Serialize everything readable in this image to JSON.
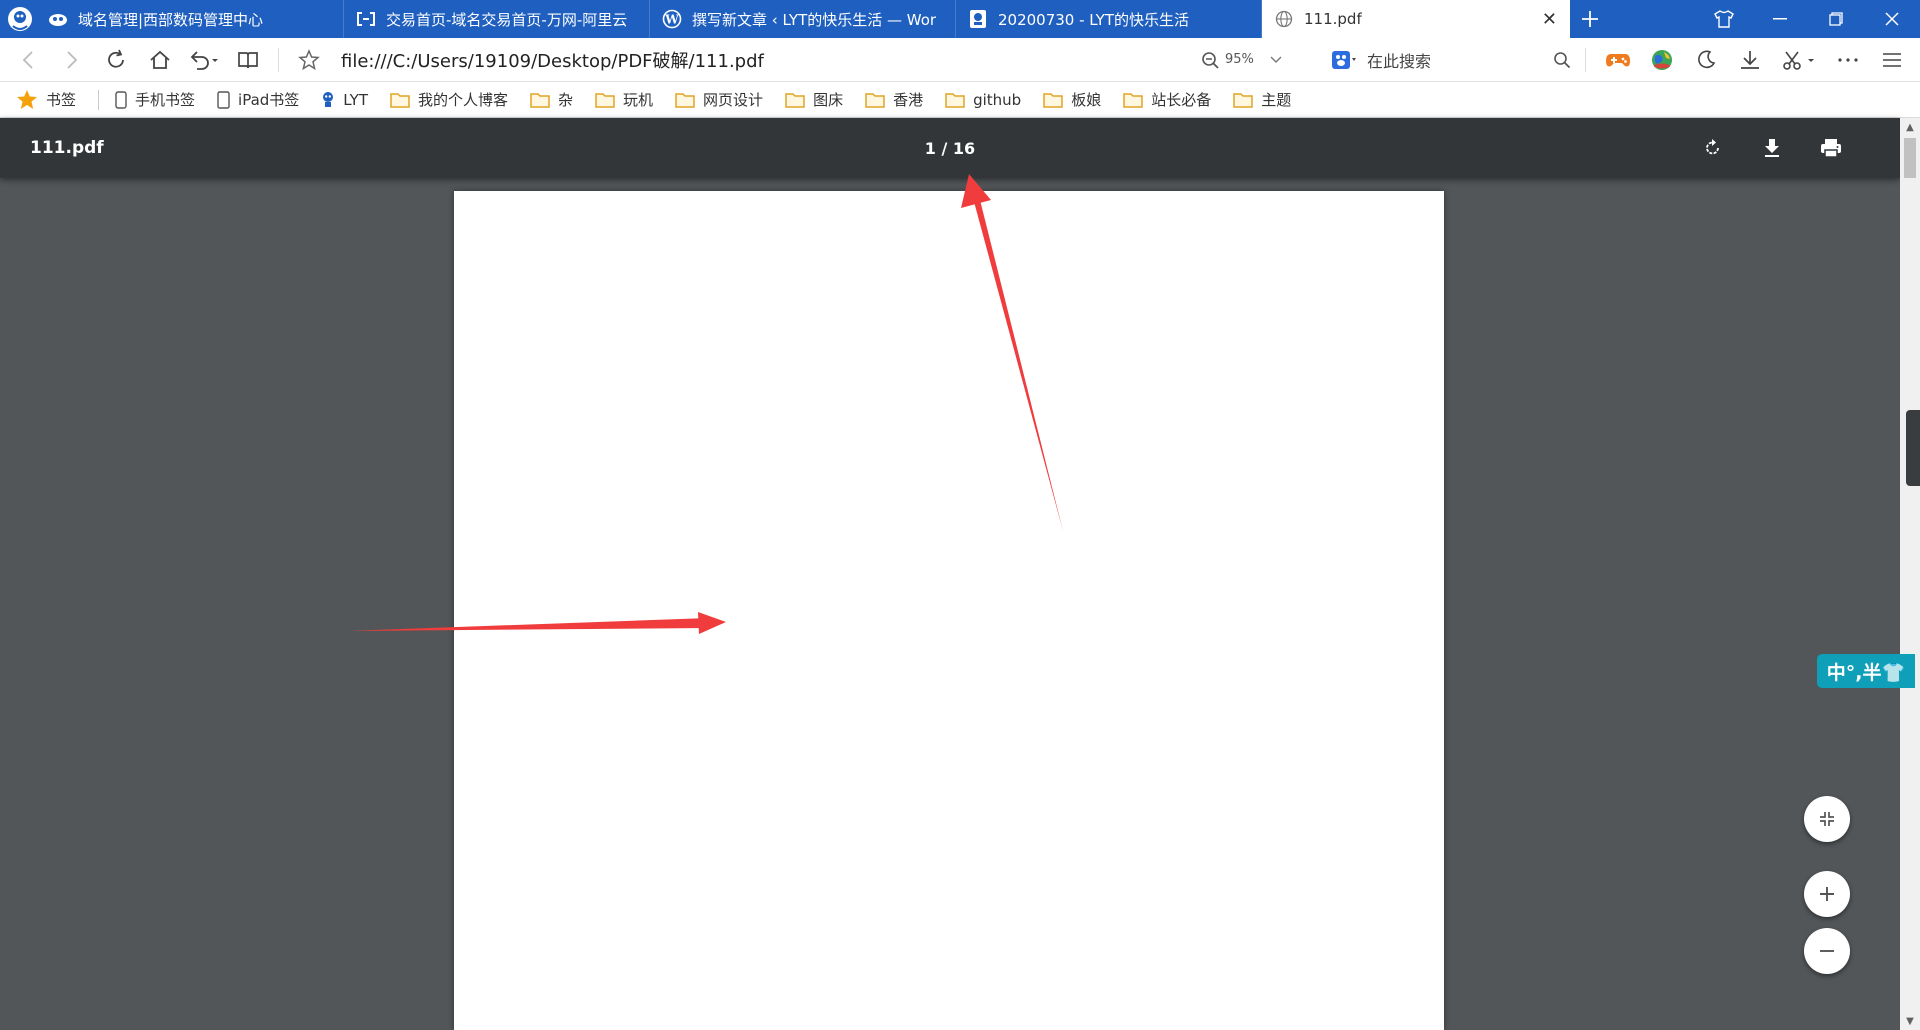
{
  "tabs": [
    {
      "title": "域名管理|西部数码管理中心",
      "icon": "west-digital-icon"
    },
    {
      "title": "交易首页-域名交易首页-万网-阿里云",
      "icon": "aliyun-icon"
    },
    {
      "title": "撰写新文章 ‹ LYT的快乐生活 — Wor",
      "icon": "wordpress-icon"
    },
    {
      "title": "20200730 - LYT的快乐生活",
      "icon": "site-icon"
    },
    {
      "title": "111.pdf",
      "icon": "globe-icon",
      "active": true
    }
  ],
  "address": {
    "url": "file:///C:/Users/19109/Desktop/PDF破解/111.pdf",
    "zoom": "95%",
    "search_placeholder": "在此搜索"
  },
  "bookmarks": [
    {
      "label": "书签",
      "icon": "star-icon"
    },
    {
      "label": "手机书签",
      "icon": "phone-icon"
    },
    {
      "label": "iPad书签",
      "icon": "tablet-icon"
    },
    {
      "label": "LYT",
      "icon": "site-icon"
    },
    {
      "label": "我的个人博客",
      "icon": "folder-icon"
    },
    {
      "label": "杂",
      "icon": "folder-icon"
    },
    {
      "label": "玩机",
      "icon": "folder-icon"
    },
    {
      "label": "网页设计",
      "icon": "folder-icon"
    },
    {
      "label": "图床",
      "icon": "folder-icon"
    },
    {
      "label": "香港",
      "icon": "folder-icon"
    },
    {
      "label": "github",
      "icon": "folder-icon"
    },
    {
      "label": "板娘",
      "icon": "folder-icon"
    },
    {
      "label": "站长必备",
      "icon": "folder-icon"
    },
    {
      "label": "主题",
      "icon": "folder-icon"
    }
  ],
  "pdf": {
    "filename": "111.pdf",
    "page_indicator": "1 / 16"
  },
  "ime": {
    "label": "中°,半👕"
  },
  "colors": {
    "tabbar": "#1f5fbf",
    "pdf_toolbar": "#323639",
    "viewer_bg": "#525659",
    "annotation_arrow": "#f03c3c",
    "ime_badge": "#0f9fb8"
  }
}
